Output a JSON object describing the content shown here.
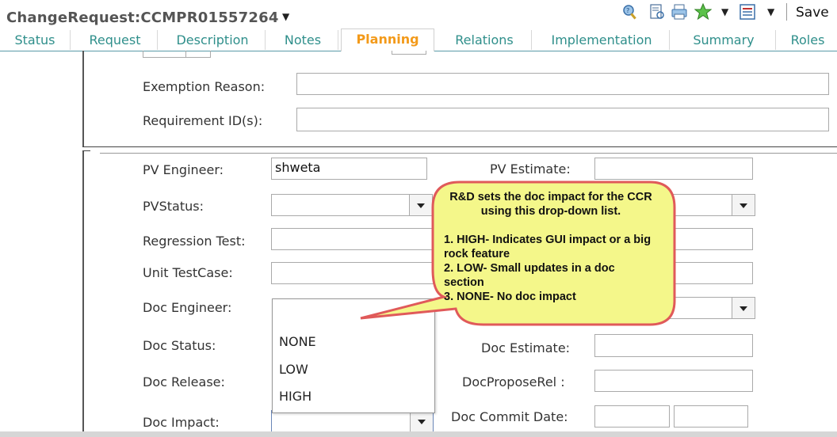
{
  "header": {
    "title": "ChangeRequest:CCMPR01557264",
    "save_label": "Save",
    "toolbar_icons": [
      "help-search-icon",
      "report-icon",
      "print-icon",
      "favorite-star-icon",
      "list-view-icon"
    ]
  },
  "tabs": [
    {
      "label": "Status"
    },
    {
      "label": "Request"
    },
    {
      "label": "Description"
    },
    {
      "label": "Notes"
    },
    {
      "label": "Planning",
      "active": true
    },
    {
      "label": "Relations"
    },
    {
      "label": "Implementation"
    },
    {
      "label": "Summary"
    },
    {
      "label": "Roles"
    }
  ],
  "section1": {
    "exemption_reason_label": "Exemption Reason:",
    "exemption_reason_value": "",
    "requirement_ids_label": "Requirement ID(s):",
    "requirement_ids_value": ""
  },
  "section2": {
    "pv_engineer_label": "PV Engineer:",
    "pv_engineer_value": "shweta",
    "pv_estimate_label": "PV Estimate:",
    "pv_status_label": "PVStatus:",
    "regression_test_label": "Regression Test:",
    "unit_testcase_label": "Unit TestCase:",
    "doc_engineer_label": "Doc Engineer:",
    "doc_status_label": "Doc Status:",
    "doc_estimate_label": "Doc Estimate:",
    "doc_release_label": "Doc Release:",
    "doc_propose_rel_label": "DocProposeRel :",
    "doc_impact_label": "Doc Impact:",
    "doc_commit_date_label": "Doc Commit Date:"
  },
  "doc_impact_options": [
    "NONE",
    "LOW",
    "HIGH"
  ],
  "callout": {
    "heading": "R&D sets the doc impact for the CCR using this drop-down list.",
    "lines": [
      "1. HIGH- Indicates GUI impact or a big rock feature",
      "2. LOW- Small updates in a doc section",
      "3. NONE- No doc impact"
    ],
    "fill_color": "#f4f78a",
    "border_color": "#e05a5a"
  },
  "colors": {
    "tab_text": "#2f8f8b",
    "tab_active": "#f39a1a"
  }
}
